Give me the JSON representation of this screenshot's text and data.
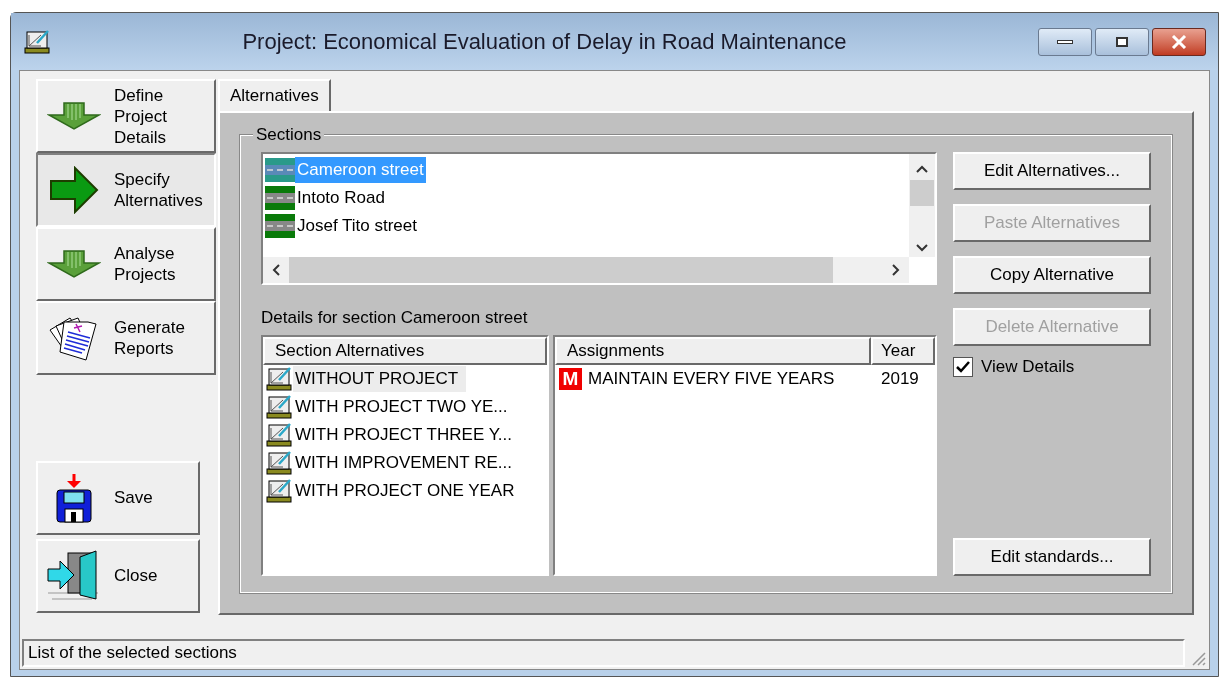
{
  "window": {
    "title": "Project: Economical Evaluation of Delay in Road Maintenance"
  },
  "sidebar": {
    "items": [
      {
        "label": "Define Project Details",
        "kind": "down",
        "selected": false
      },
      {
        "label": "Specify Alternatives",
        "kind": "right",
        "selected": true
      },
      {
        "label": "Analyse Projects",
        "kind": "down",
        "selected": false
      },
      {
        "label": "Generate Reports",
        "kind": "reports",
        "selected": false
      }
    ],
    "actions": [
      {
        "label": "Save",
        "kind": "save"
      },
      {
        "label": "Close",
        "kind": "close"
      }
    ]
  },
  "tabs": [
    {
      "label": "Alternatives",
      "selected": true
    }
  ],
  "sections": {
    "title": "Sections",
    "items": [
      {
        "label": "Cameroon street",
        "selected": true
      },
      {
        "label": "Intoto Road",
        "selected": false
      },
      {
        "label": "Josef Tito street",
        "selected": false
      }
    ]
  },
  "details_label": "Details for section Cameroon street",
  "alternatives": {
    "column": "Section Alternatives",
    "items": [
      {
        "label": "WITHOUT PROJECT",
        "selected": true
      },
      {
        "label": "WITH PROJECT TWO YE...",
        "selected": false
      },
      {
        "label": "WITH PROJECT THREE Y...",
        "selected": false
      },
      {
        "label": "WITH IMPROVEMENT RE...",
        "selected": false
      },
      {
        "label": "WITH PROJECT ONE YEAR",
        "selected": false
      }
    ]
  },
  "assignments": {
    "columns": [
      "Assignments",
      "Year"
    ],
    "rows": [
      {
        "badge": "M",
        "name": "MAINTAIN EVERY FIVE YEARS",
        "year": "2019"
      }
    ]
  },
  "buttons": [
    {
      "label": "Edit Alternatives...",
      "disabled": false
    },
    {
      "label": "Paste Alternatives",
      "disabled": true
    },
    {
      "label": "Copy Alternative",
      "disabled": false
    },
    {
      "label": "Delete Alternative",
      "disabled": true
    }
  ],
  "view_details": {
    "label": "View Details",
    "checked": true
  },
  "edit_standards": {
    "label": "Edit standards...",
    "disabled": false
  },
  "status_bar": "List of the selected sections"
}
